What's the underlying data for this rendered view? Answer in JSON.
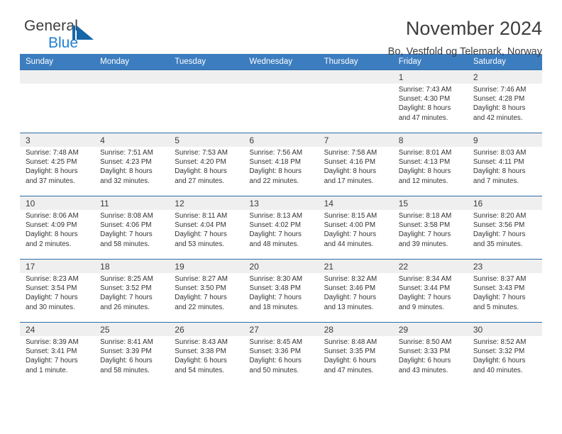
{
  "brand": {
    "name_top": "General",
    "name_bottom": "Blue",
    "mark": "triangle-flag-icon",
    "color_blue": "#1f7fd0"
  },
  "header": {
    "title": "November 2024",
    "subtitle": "Bo, Vestfold og Telemark, Norway"
  },
  "colors": {
    "header_blue": "#3c7dc0",
    "row_border_blue": "#2e6da8",
    "daynum_band": "#efeff0"
  },
  "calendar": {
    "weekday_headers": [
      "Sunday",
      "Monday",
      "Tuesday",
      "Wednesday",
      "Thursday",
      "Friday",
      "Saturday"
    ],
    "weeks": [
      [
        {
          "day": "",
          "lines": []
        },
        {
          "day": "",
          "lines": []
        },
        {
          "day": "",
          "lines": []
        },
        {
          "day": "",
          "lines": []
        },
        {
          "day": "",
          "lines": []
        },
        {
          "day": "1",
          "lines": [
            "Sunrise: 7:43 AM",
            "Sunset: 4:30 PM",
            "Daylight: 8 hours",
            "and 47 minutes."
          ]
        },
        {
          "day": "2",
          "lines": [
            "Sunrise: 7:46 AM",
            "Sunset: 4:28 PM",
            "Daylight: 8 hours",
            "and 42 minutes."
          ]
        }
      ],
      [
        {
          "day": "3",
          "lines": [
            "Sunrise: 7:48 AM",
            "Sunset: 4:25 PM",
            "Daylight: 8 hours",
            "and 37 minutes."
          ]
        },
        {
          "day": "4",
          "lines": [
            "Sunrise: 7:51 AM",
            "Sunset: 4:23 PM",
            "Daylight: 8 hours",
            "and 32 minutes."
          ]
        },
        {
          "day": "5",
          "lines": [
            "Sunrise: 7:53 AM",
            "Sunset: 4:20 PM",
            "Daylight: 8 hours",
            "and 27 minutes."
          ]
        },
        {
          "day": "6",
          "lines": [
            "Sunrise: 7:56 AM",
            "Sunset: 4:18 PM",
            "Daylight: 8 hours",
            "and 22 minutes."
          ]
        },
        {
          "day": "7",
          "lines": [
            "Sunrise: 7:58 AM",
            "Sunset: 4:16 PM",
            "Daylight: 8 hours",
            "and 17 minutes."
          ]
        },
        {
          "day": "8",
          "lines": [
            "Sunrise: 8:01 AM",
            "Sunset: 4:13 PM",
            "Daylight: 8 hours",
            "and 12 minutes."
          ]
        },
        {
          "day": "9",
          "lines": [
            "Sunrise: 8:03 AM",
            "Sunset: 4:11 PM",
            "Daylight: 8 hours",
            "and 7 minutes."
          ]
        }
      ],
      [
        {
          "day": "10",
          "lines": [
            "Sunrise: 8:06 AM",
            "Sunset: 4:09 PM",
            "Daylight: 8 hours",
            "and 2 minutes."
          ]
        },
        {
          "day": "11",
          "lines": [
            "Sunrise: 8:08 AM",
            "Sunset: 4:06 PM",
            "Daylight: 7 hours",
            "and 58 minutes."
          ]
        },
        {
          "day": "12",
          "lines": [
            "Sunrise: 8:11 AM",
            "Sunset: 4:04 PM",
            "Daylight: 7 hours",
            "and 53 minutes."
          ]
        },
        {
          "day": "13",
          "lines": [
            "Sunrise: 8:13 AM",
            "Sunset: 4:02 PM",
            "Daylight: 7 hours",
            "and 48 minutes."
          ]
        },
        {
          "day": "14",
          "lines": [
            "Sunrise: 8:15 AM",
            "Sunset: 4:00 PM",
            "Daylight: 7 hours",
            "and 44 minutes."
          ]
        },
        {
          "day": "15",
          "lines": [
            "Sunrise: 8:18 AM",
            "Sunset: 3:58 PM",
            "Daylight: 7 hours",
            "and 39 minutes."
          ]
        },
        {
          "day": "16",
          "lines": [
            "Sunrise: 8:20 AM",
            "Sunset: 3:56 PM",
            "Daylight: 7 hours",
            "and 35 minutes."
          ]
        }
      ],
      [
        {
          "day": "17",
          "lines": [
            "Sunrise: 8:23 AM",
            "Sunset: 3:54 PM",
            "Daylight: 7 hours",
            "and 30 minutes."
          ]
        },
        {
          "day": "18",
          "lines": [
            "Sunrise: 8:25 AM",
            "Sunset: 3:52 PM",
            "Daylight: 7 hours",
            "and 26 minutes."
          ]
        },
        {
          "day": "19",
          "lines": [
            "Sunrise: 8:27 AM",
            "Sunset: 3:50 PM",
            "Daylight: 7 hours",
            "and 22 minutes."
          ]
        },
        {
          "day": "20",
          "lines": [
            "Sunrise: 8:30 AM",
            "Sunset: 3:48 PM",
            "Daylight: 7 hours",
            "and 18 minutes."
          ]
        },
        {
          "day": "21",
          "lines": [
            "Sunrise: 8:32 AM",
            "Sunset: 3:46 PM",
            "Daylight: 7 hours",
            "and 13 minutes."
          ]
        },
        {
          "day": "22",
          "lines": [
            "Sunrise: 8:34 AM",
            "Sunset: 3:44 PM",
            "Daylight: 7 hours",
            "and 9 minutes."
          ]
        },
        {
          "day": "23",
          "lines": [
            "Sunrise: 8:37 AM",
            "Sunset: 3:43 PM",
            "Daylight: 7 hours",
            "and 5 minutes."
          ]
        }
      ],
      [
        {
          "day": "24",
          "lines": [
            "Sunrise: 8:39 AM",
            "Sunset: 3:41 PM",
            "Daylight: 7 hours",
            "and 1 minute."
          ]
        },
        {
          "day": "25",
          "lines": [
            "Sunrise: 8:41 AM",
            "Sunset: 3:39 PM",
            "Daylight: 6 hours",
            "and 58 minutes."
          ]
        },
        {
          "day": "26",
          "lines": [
            "Sunrise: 8:43 AM",
            "Sunset: 3:38 PM",
            "Daylight: 6 hours",
            "and 54 minutes."
          ]
        },
        {
          "day": "27",
          "lines": [
            "Sunrise: 8:45 AM",
            "Sunset: 3:36 PM",
            "Daylight: 6 hours",
            "and 50 minutes."
          ]
        },
        {
          "day": "28",
          "lines": [
            "Sunrise: 8:48 AM",
            "Sunset: 3:35 PM",
            "Daylight: 6 hours",
            "and 47 minutes."
          ]
        },
        {
          "day": "29",
          "lines": [
            "Sunrise: 8:50 AM",
            "Sunset: 3:33 PM",
            "Daylight: 6 hours",
            "and 43 minutes."
          ]
        },
        {
          "day": "30",
          "lines": [
            "Sunrise: 8:52 AM",
            "Sunset: 3:32 PM",
            "Daylight: 6 hours",
            "and 40 minutes."
          ]
        }
      ]
    ]
  }
}
